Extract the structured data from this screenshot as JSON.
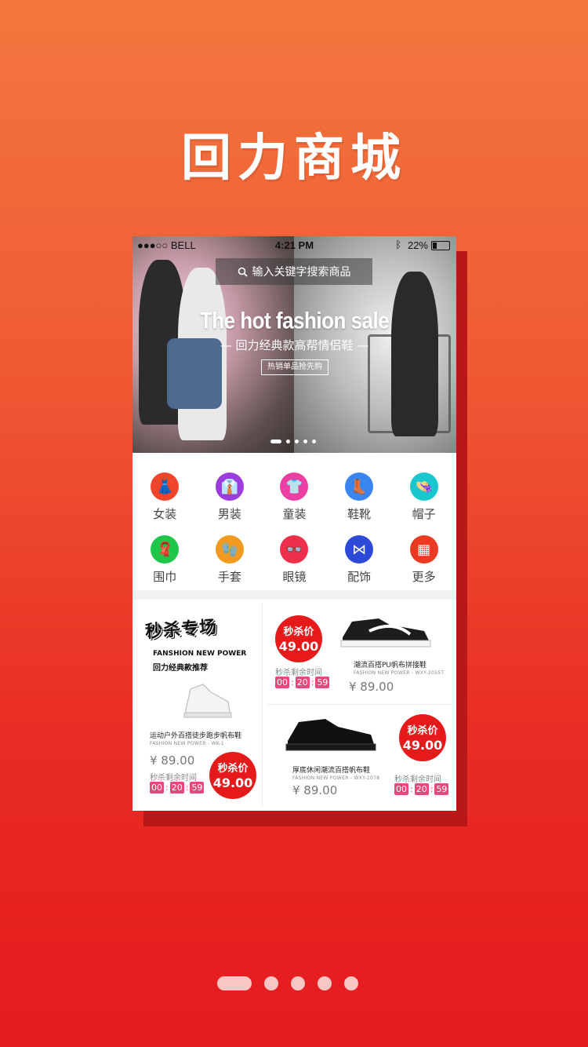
{
  "app_title": "回力商城",
  "status_bar": {
    "carrier": "●●●○○ BELL",
    "time": "4:21 PM",
    "battery": "22%"
  },
  "search": {
    "placeholder": "输入关键字搜索商品"
  },
  "banner": {
    "headline": "The hot fashion sale",
    "subtitle": "— 回力经典款高帮情侣鞋 —",
    "button": "热销单品抢先购"
  },
  "categories": [
    {
      "label": "女装",
      "icon": "dress-icon",
      "color": "#f0442b"
    },
    {
      "label": "男装",
      "icon": "shirt-icon",
      "color": "#9b3ddc"
    },
    {
      "label": "童装",
      "icon": "kids-shirt-icon",
      "color": "#ec3fa3"
    },
    {
      "label": "鞋靴",
      "icon": "boot-icon",
      "color": "#3a86f0"
    },
    {
      "label": "帽子",
      "icon": "hat-icon",
      "color": "#19c7cf"
    },
    {
      "label": "围巾",
      "icon": "scarf-icon",
      "color": "#1fc64a"
    },
    {
      "label": "手套",
      "icon": "glove-icon",
      "color": "#f29a1f"
    },
    {
      "label": "眼镜",
      "icon": "glasses-icon",
      "color": "#ee2f4b"
    },
    {
      "label": "配饰",
      "icon": "tie-icon",
      "color": "#2d49d8"
    },
    {
      "label": "更多",
      "icon": "more-grid-icon",
      "color": "#ec3a22"
    }
  ],
  "flash_sale": {
    "logo": "秒杀专场",
    "brand_en": "FANSHION NEW POWER",
    "brand_cn": "回力经典款推荐",
    "badge_title": "秒杀价",
    "badge_price": "49.00",
    "countdown_label": "秒杀剩余时间",
    "countdown": [
      "00",
      "20",
      "59"
    ],
    "products": [
      {
        "name": "运动户外百搭徒步跑步帆布鞋",
        "code": "FASHION NEW POWER - WK-1",
        "price": "¥ 89.00"
      },
      {
        "name": "潮流百搭PU帆布拼接鞋",
        "code": "FASHION NEW POWER - WXY-2055T",
        "price": "¥ 89.00"
      },
      {
        "name": "厚底休闲潮流百搭帆布鞋",
        "code": "FASHION NEW POWER - WXY-1078",
        "price": "¥ 89.00"
      }
    ]
  },
  "pager": {
    "count": 5,
    "active": 0
  }
}
